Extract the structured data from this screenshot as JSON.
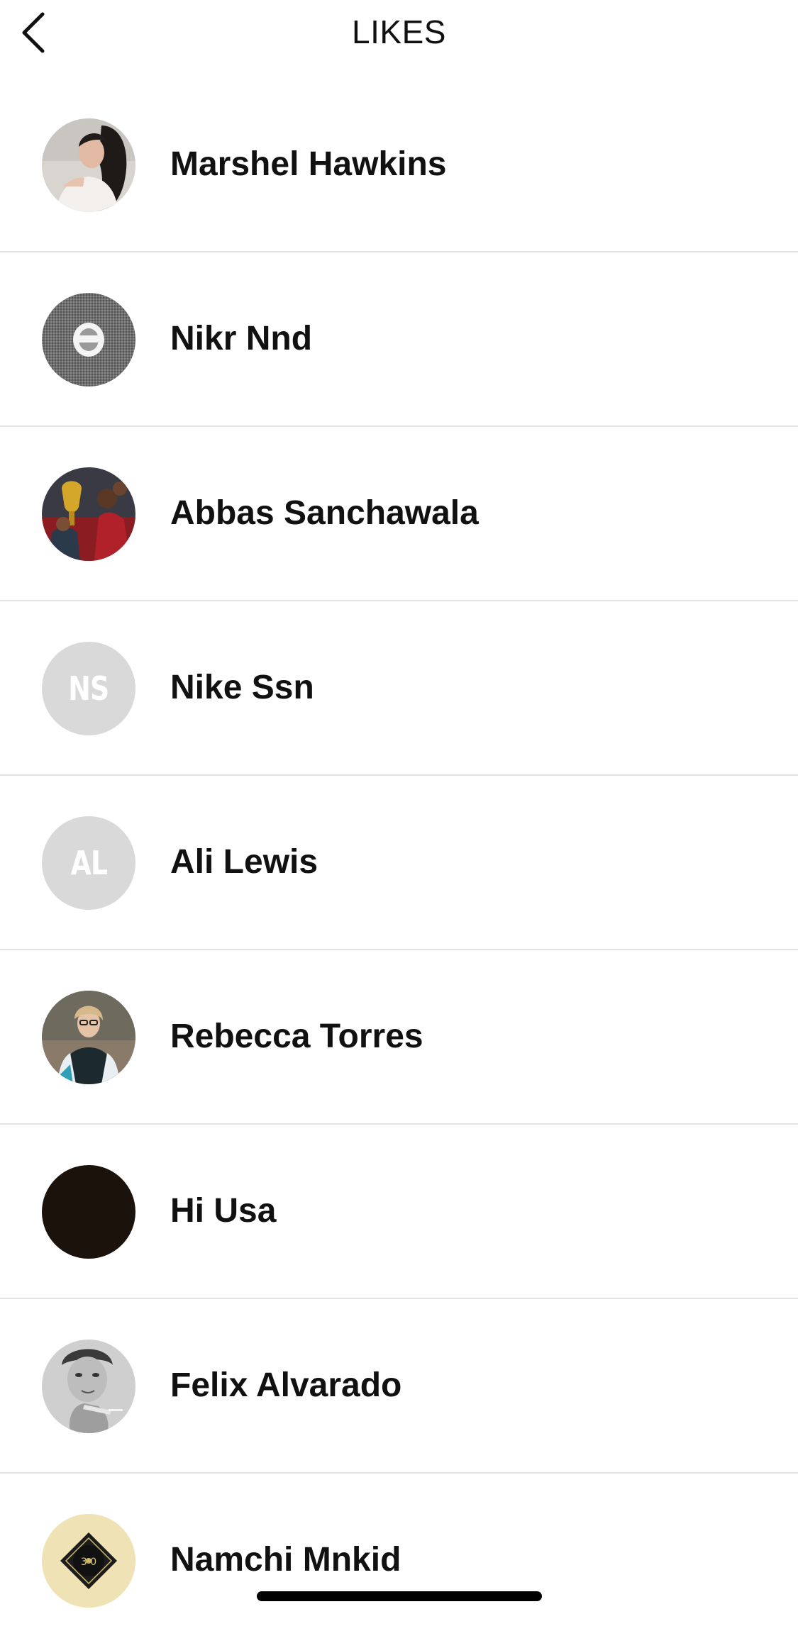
{
  "header": {
    "title": "LIKES",
    "back_icon": "chevron-left-icon"
  },
  "likes": [
    {
      "name": "Marshel Hawkins",
      "avatar_type": "photo",
      "avatar_desc": "woman-smiling"
    },
    {
      "name": "Nikr Nnd",
      "avatar_type": "photo",
      "avatar_desc": "grey-fabric-emblem"
    },
    {
      "name": "Abbas Sanchawala",
      "avatar_type": "photo",
      "avatar_desc": "group-with-trophy"
    },
    {
      "name": "Nike Ssn",
      "avatar_type": "initials",
      "initials": "NS"
    },
    {
      "name": "Ali Lewis",
      "avatar_type": "initials",
      "initials": "AL"
    },
    {
      "name": "Rebecca Torres",
      "avatar_type": "photo",
      "avatar_desc": "woman-with-glasses"
    },
    {
      "name": "Hi Usa",
      "avatar_type": "photo",
      "avatar_desc": "dark"
    },
    {
      "name": "Felix Alvarado",
      "avatar_type": "photo",
      "avatar_desc": "man-black-and-white"
    },
    {
      "name": "Namchi Mnkid",
      "avatar_type": "photo",
      "avatar_desc": "badge-logo",
      "badge_text": "3 0"
    }
  ],
  "colors": {
    "divider": "#e3e3e3",
    "initials_bg": "#d9d9d9",
    "text": "#111111"
  }
}
